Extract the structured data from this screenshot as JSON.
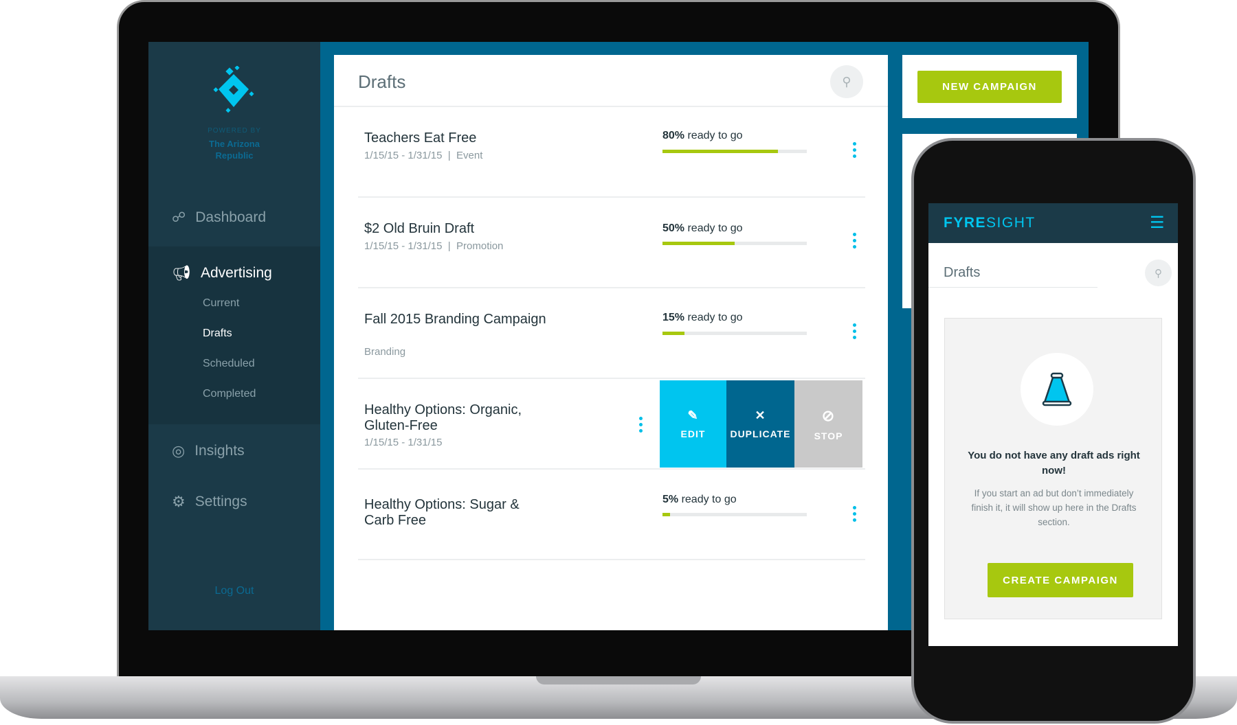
{
  "sidebar": {
    "powered_by": "POWERED BY",
    "brand_line1": "The Arizona",
    "brand_line2": "Republic",
    "items": [
      {
        "label": "Dashboard",
        "icon": "dashboard-icon"
      },
      {
        "label": "Advertising",
        "icon": "megaphone-icon"
      },
      {
        "label": "Insights",
        "icon": "target-icon"
      },
      {
        "label": "Settings",
        "icon": "gear-icon"
      }
    ],
    "subitems": [
      "Current",
      "Drafts",
      "Scheduled",
      "Completed"
    ],
    "logout": "Log Out"
  },
  "main": {
    "title": "Drafts",
    "rows": [
      {
        "title": "Teachers Eat Free",
        "dates": "1/15/15 - 1/31/15",
        "type": "Event",
        "percent": 80,
        "pct_label": "80%",
        "ready": " ready to go"
      },
      {
        "title": "$2 Old Bruin Draft",
        "dates": "1/15/15 - 1/31/15",
        "type": "Promotion",
        "percent": 50,
        "pct_label": "50%",
        "ready": " ready to go"
      },
      {
        "title": "Fall 2015 Branding Campaign",
        "type": "Branding",
        "percent": 15,
        "pct_label": "15%",
        "ready": " ready to go"
      },
      {
        "title": "Healthy Options: Organic, Gluten-Free",
        "dates": "1/15/15 - 1/31/15"
      },
      {
        "title": "Healthy Options: Sugar & Carb Free",
        "percent": 5,
        "pct_label": "5%",
        "ready": " ready to go"
      }
    ],
    "actions": {
      "edit": "EDIT",
      "duplicate": "DUPLICATE",
      "stop": "STOP"
    }
  },
  "new_campaign": "NEW CAMPAIGN",
  "mobile": {
    "brand_bold": "FYRE",
    "brand_light": "SIGHT",
    "title": "Drafts",
    "empty_heading": "You do not have any draft ads right now!",
    "empty_body": "If you start an ad but don’t immediately finish it, it will show up here in the Drafts section.",
    "create": "CREATE CAMPAIGN"
  },
  "colors": {
    "sidebar": "#1b3a48",
    "accent": "#00c5ef",
    "brand_blue": "#00668f",
    "green": "#a7c80f",
    "stop_gray": "#c9c9c9"
  }
}
